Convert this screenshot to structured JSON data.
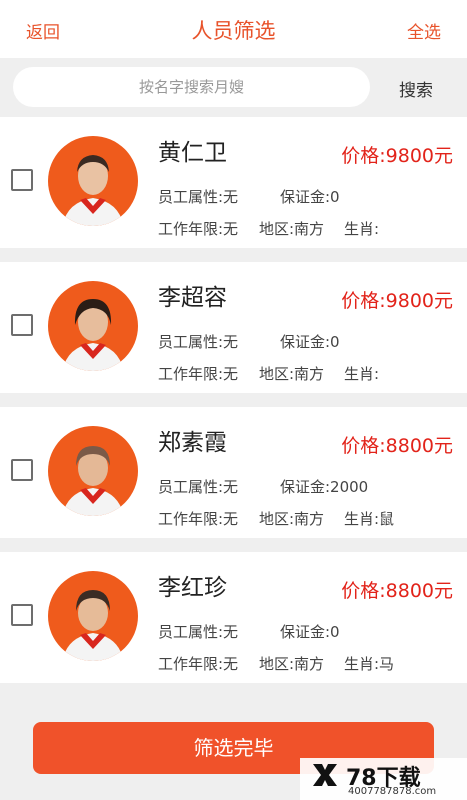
{
  "header": {
    "back_label": "返回",
    "title": "人员筛选",
    "select_all_label": "全选"
  },
  "search": {
    "placeholder": "按名字搜索月嫂",
    "button_label": "搜索"
  },
  "staff": [
    {
      "name": "黄仁卫",
      "price": "价格:9800元",
      "attr": "员工属性:无",
      "deposit": "保证金:0",
      "years": "工作年限:无",
      "region": "地区:南方",
      "zodiac": "生肖:"
    },
    {
      "name": "李超容",
      "price": "价格:9800元",
      "attr": "员工属性:无",
      "deposit": "保证金:0",
      "years": "工作年限:无",
      "region": "地区:南方",
      "zodiac": "生肖:"
    },
    {
      "name": "郑素霞",
      "price": "价格:8800元",
      "attr": "员工属性:无",
      "deposit": "保证金:2000",
      "years": "工作年限:无",
      "region": "地区:南方",
      "zodiac": "生肖:鼠"
    },
    {
      "name": "李红珍",
      "price": "价格:8800元",
      "attr": "员工属性:无",
      "deposit": "保证金:0",
      "years": "工作年限:无",
      "region": "地区:南方",
      "zodiac": "生肖:马"
    }
  ],
  "footer": {
    "done_label": "筛选完毕"
  },
  "watermark": {
    "brand": "78下载",
    "site": "4007787878.com"
  },
  "colors": {
    "accent": "#e8532b",
    "price": "#e2231a",
    "button": "#f0522a",
    "avatar_bg": "#ef5b1c"
  }
}
